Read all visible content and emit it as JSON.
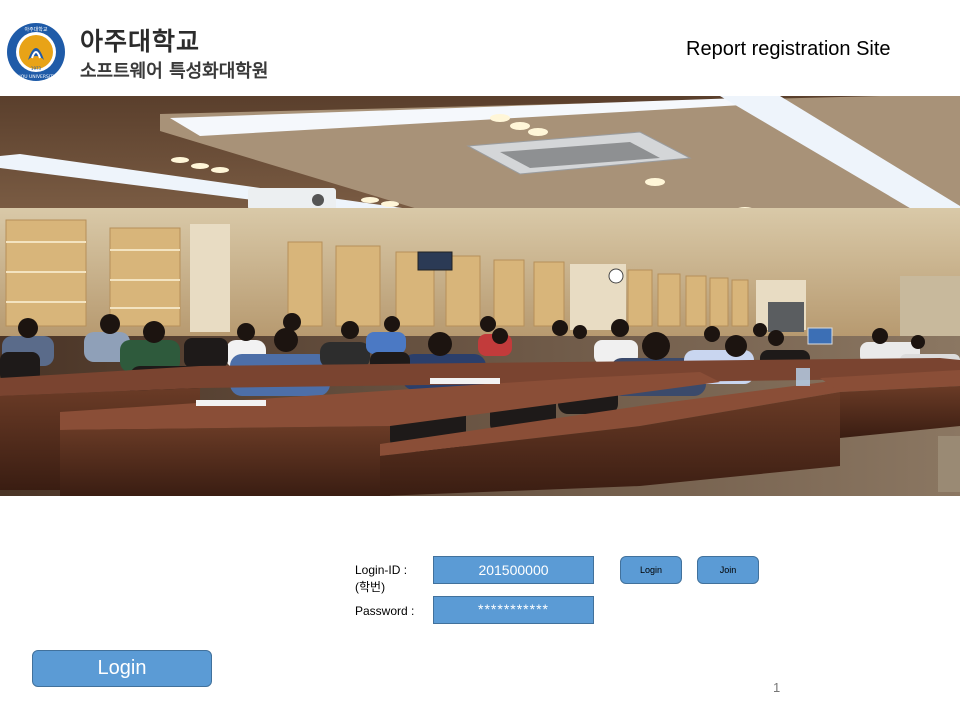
{
  "header": {
    "university_name": "아주대학교",
    "department": "소프트웨어 특성화대학원",
    "site_title": "Report registration Site",
    "logo": {
      "icon": "ajou-university-seal-icon",
      "ring_text": "아주대학교 AJOU UNIVERSITY",
      "year": "1973",
      "color": "#1f5ba8"
    }
  },
  "hero": {
    "description": "lecture-hall-photo-icon"
  },
  "login_form": {
    "id_label": "Login-ID :",
    "id_sublabel": "(학번)",
    "id_value": "201500000",
    "password_label": "Password :",
    "password_value": "***********",
    "login_button": "Login",
    "join_button": "Join"
  },
  "footer": {
    "big_login_button": "Login",
    "page_number": "1"
  },
  "colors": {
    "accent": "#5b9bd5",
    "accent_border": "#41719c"
  }
}
